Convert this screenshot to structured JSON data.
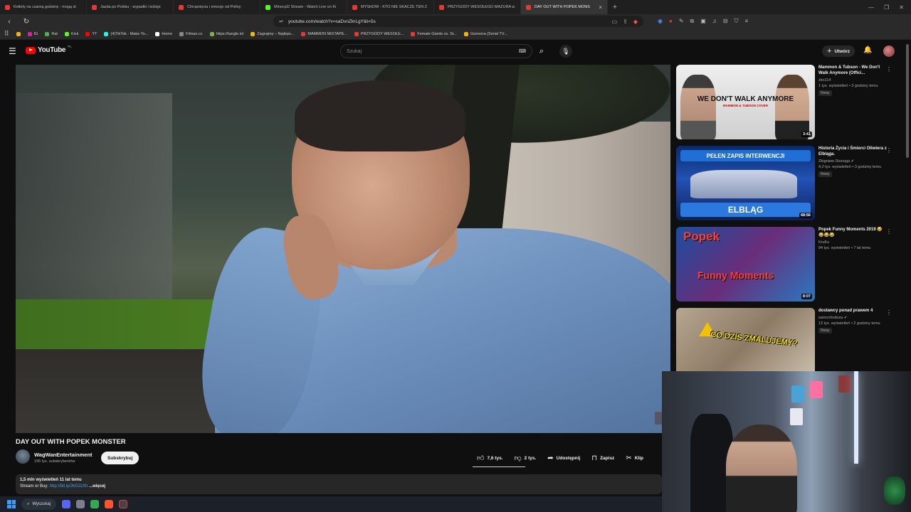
{
  "browser": {
    "tabs": [
      {
        "label": "Kotlety na czarną godzinę - mogą st",
        "color": "#e53935",
        "active": false
      },
      {
        "label": "Jazda po Polsku - wypadki i kolizje",
        "color": "#e53935",
        "active": false
      },
      {
        "label": "Chrupnięcia i emocje od Poliny",
        "color": "#e53935",
        "active": false
      },
      {
        "label": "Minecpl2 Stream - Watch Live on Ki",
        "color": "#53fc18",
        "active": false
      },
      {
        "label": "MYSHOW - KTO NIE SKACZE TEN Z",
        "color": "#e53935",
        "active": false
      },
      {
        "label": "PRZYGODY WESOŁEGO MAZURA w",
        "color": "#e53935",
        "active": false
      },
      {
        "label": "DAY OUT WITH POPEK MONS",
        "color": "#e53935",
        "active": true
      }
    ],
    "url": "youtube.com/watch?v=saDvnZkrLgY&t=5s",
    "bookmarks": [
      {
        "label": "IG",
        "color": "#d6249f"
      },
      {
        "label": "Rat",
        "color": "#4caf50"
      },
      {
        "label": "Kick",
        "color": "#53fc18"
      },
      {
        "label": "YT",
        "color": "#ff0000"
      },
      {
        "label": "(4)TikTok - Make Yo...",
        "color": "#25f4ee"
      },
      {
        "label": "Home",
        "color": "#ffffff"
      },
      {
        "label": "Filman.cc",
        "color": "#888888"
      },
      {
        "label": "https://tangle.io/",
        "color": "#7cb342"
      },
      {
        "label": "Zagrajmy – Najleps...",
        "color": "#f4b400"
      },
      {
        "label": "MAMMON MIXTAPE...",
        "color": "#e53935"
      },
      {
        "label": "PRZYGODY WESOŁE...",
        "color": "#e53935"
      },
      {
        "label": "Female Giants vs. St...",
        "color": "#e53935"
      },
      {
        "label": "Gomorra (Serial TV...",
        "color": "#f4b400"
      }
    ]
  },
  "youtube": {
    "logo_text": "YouTube",
    "logo_country": "PL",
    "search_placeholder": "Szukaj",
    "create_label": "Utwórz"
  },
  "video": {
    "title": "DAY OUT WITH POPEK MONSTER",
    "channel": "WagWanEntertainment",
    "subscribers": "195 tys. subskrybentów",
    "subscribe_label": "Subskrybuj",
    "likes": "7,6 tys.",
    "dislikes": "2 tys.",
    "share_label": "Udostępnij",
    "save_label": "Zapisz",
    "clip_label": "Klip",
    "views_date": "1,5 mln wyświetleń  11 lat temu",
    "desc_prefix": "Stream or Buy:",
    "desc_link": "http://bit.ly/2kG2zXh",
    "more_label": "...więcej"
  },
  "recommendations": [
    {
      "title": "Mammon & Tubson - We Don't Walk Anymore (Offici...",
      "channel": "zko114",
      "meta": "1 tys. wyświetleń • 3 godziny temu",
      "badge": "Nowy",
      "duration": "3:41",
      "thumb_text": "WE DON'T WALK ANYMORE",
      "thumb_sub": "MAMMON & TUBSON COVER"
    },
    {
      "title": "Historia Życia i Śmierci Oliwiera z Elbląga.",
      "channel": "Zbigniew Stonoga",
      "meta": "4,2 tys. wyświetleń • 3 godziny temu",
      "badge": "Nowy",
      "duration": "48:56",
      "thumb_text": "PEŁEN ZAPIS INTERWENCJI",
      "thumb_sub": "ELBLĄG"
    },
    {
      "title": "Popek Funny Moments 2019 😂😂😂😂",
      "channel": "KruKu",
      "meta": "94 tys. wyświetleń • 7 lat temu",
      "badge": "",
      "duration": "8:07",
      "thumb_text": "Popek",
      "thumb_sub": "Funny Moments"
    },
    {
      "title": "dostawcy ponad prawem 4",
      "channel": "samochodoza",
      "meta": "13 tys. wyświetleń • 2 godziny temu",
      "badge": "Nowy",
      "duration": "",
      "thumb_text": "CO DZIS ZMALUJEMY?",
      "thumb_sub": ""
    }
  ],
  "taskbar": {
    "search_label": "Wyszukaj"
  }
}
